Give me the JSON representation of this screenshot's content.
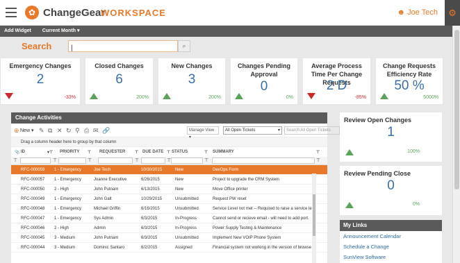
{
  "header": {
    "brand": "ChangeGear",
    "workspace": "WORKSPACE",
    "user": "Joe Tech",
    "logo_glyph": "✿",
    "user_icon": "person-icon",
    "gear_icon": "gear-icon"
  },
  "toolbar": {
    "add_widget": "Add Widget",
    "current_month": "Current Month ▾"
  },
  "search": {
    "label": "Search",
    "placeholder": "",
    "value": "|",
    "button": "⌕"
  },
  "kpis": [
    {
      "title": "Emergency Changes",
      "value": "2",
      "pct": "-33%",
      "trend": "down"
    },
    {
      "title": "Closed Changes",
      "value": "6",
      "pct": "200%",
      "trend": "up"
    },
    {
      "title": "New Changes",
      "value": "3",
      "pct": "200%",
      "trend": "up"
    },
    {
      "title": "Changes Pending Approval",
      "value": "0",
      "pct": "0%",
      "trend": "up"
    },
    {
      "title": "Average Process Time Per Change Requests",
      "value": "2 D",
      "pct": "-85%",
      "trend": "down"
    },
    {
      "title": "Change Requests Efficiency Rate",
      "value": "50 %",
      "pct": "5000%",
      "trend": "up"
    }
  ],
  "activities": {
    "title": "Change Activities",
    "new": "New ▾",
    "manage_view": "Manage View ▾",
    "filter": "All Open Tickets",
    "filter_arrow": "▾",
    "search_placeholder": "Search All Open Tickets",
    "drag_hint": "Drag a column header here to group by that column",
    "columns": [
      "ID",
      "PRIORITY",
      "REQUESTER",
      "DUE DATE",
      "STATUS",
      "SUMMARY"
    ],
    "rows": [
      [
        "RFC-000059",
        "1 - Emergency",
        "Joe Tech",
        "10/30/2015",
        "New",
        "DevOps Form"
      ],
      [
        "RFC-000057",
        "1 - Emergency",
        "Joanne Executive",
        "6/26/2015",
        "New",
        "Project to upgrade the CRM System"
      ],
      [
        "RFC-000050",
        "2 - High",
        "John Putnam",
        "6/13/2015",
        "New",
        "Move Office printer"
      ],
      [
        "RFC-000049",
        "1 - Emergency",
        "John Galt",
        "10/29/2015",
        "Unsubmitted",
        "Request PW reset"
      ],
      [
        "RFC-000048",
        "1 - Emergency",
        "Michael Griffin",
        "6/16/2015",
        "Unsubmitted",
        "Service Level not met -- Required to raise a service lev"
      ],
      [
        "RFC-000047",
        "1 - Emergency",
        "Sys Admin",
        "6/3/2015",
        "In-Progress",
        "Cannot send or recieve email - will need to add port."
      ],
      [
        "RFC-000046",
        "2 - High",
        "Admin",
        "6/3/2015",
        "In-Progress",
        "Power Supply Testing & Maintenance"
      ],
      [
        "RFC-000045",
        "3 - Medium",
        "John Putnam",
        "6/3/2015",
        "Unsubmitted",
        "Implement New VOIP Phone System"
      ],
      [
        "RFC-000044",
        "3 - Medium",
        "Dominic Santaro",
        "6/2/2015",
        "Assigned",
        "Financial system not working in the version of browse"
      ]
    ]
  },
  "side": {
    "review_open": {
      "title": "Review Open Changes",
      "value": "1",
      "pct": "100%"
    },
    "review_pending": {
      "title": "Review Pending Close",
      "value": "0",
      "pct": "0%"
    }
  },
  "links": {
    "title": "My Links",
    "items": [
      "Announcement Calendar",
      "Schedule a Change",
      "SunView Software"
    ]
  },
  "colors": {
    "accent": "#e8792b",
    "value_blue": "#3a6fa5",
    "up_green": "#5da25c",
    "down_red": "#c9292f",
    "header_dark": "#5a5a5a"
  }
}
